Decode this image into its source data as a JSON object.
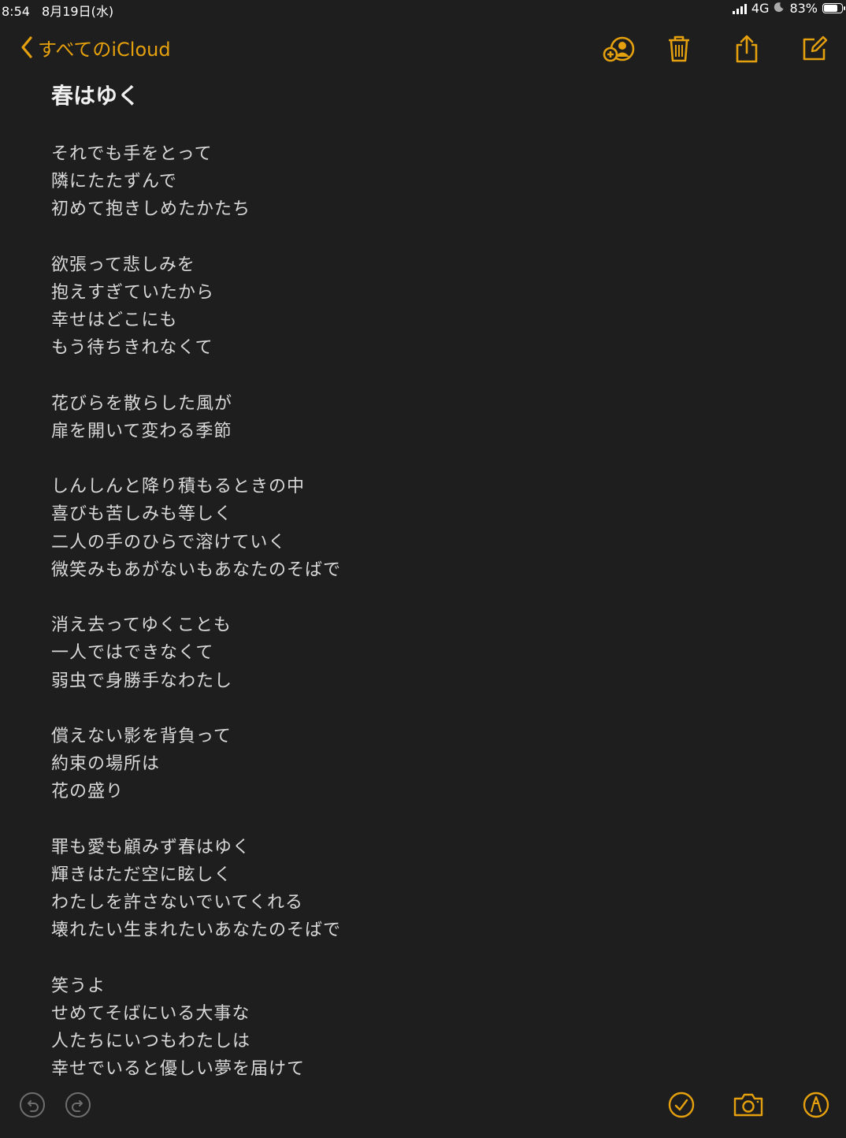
{
  "status": {
    "time": "8:54",
    "date": "8月19日(水)",
    "network": "4G",
    "battery": "83%",
    "battery_level": 0.83
  },
  "nav": {
    "back_label": "すべてのiCloud"
  },
  "colors": {
    "accent": "#e5a00d",
    "background": "#1e1e1f",
    "text": "#d9d9d9"
  },
  "icons": {
    "top": [
      "add-person-icon",
      "trash-icon",
      "share-icon",
      "compose-icon"
    ],
    "bottom": [
      "undo-icon",
      "redo-icon",
      "checklist-icon",
      "camera-icon",
      "markup-icon"
    ]
  },
  "note": {
    "title": "春はゆく",
    "stanzas": [
      [
        "それでも手をとって",
        "隣にたたずんで",
        "初めて抱きしめたかたち"
      ],
      [
        "欲張って悲しみを",
        "抱えすぎていたから",
        "幸せはどこにも",
        "もう待ちきれなくて"
      ],
      [
        "花びらを散らした風が",
        "扉を開いて変わる季節"
      ],
      [
        "しんしんと降り積もるときの中",
        "喜びも苦しみも等しく",
        "二人の手のひらで溶けていく",
        "微笑みもあがないもあなたのそばで"
      ],
      [
        "消え去ってゆくことも",
        "一人ではできなくて",
        "弱虫で身勝手なわたし"
      ],
      [
        "償えない影を背負って",
        "約束の場所は",
        "花の盛り"
      ],
      [
        "罪も愛も顧みず春はゆく",
        "輝きはただ空に眩しく",
        "わたしを許さないでいてくれる",
        "壊れたい生まれたいあなたのそばで"
      ],
      [
        "笑うよ",
        "せめてそばにいる大事な",
        "人たちにいつもわたしは",
        "幸せでいると優しい夢を届けて"
      ]
    ]
  }
}
